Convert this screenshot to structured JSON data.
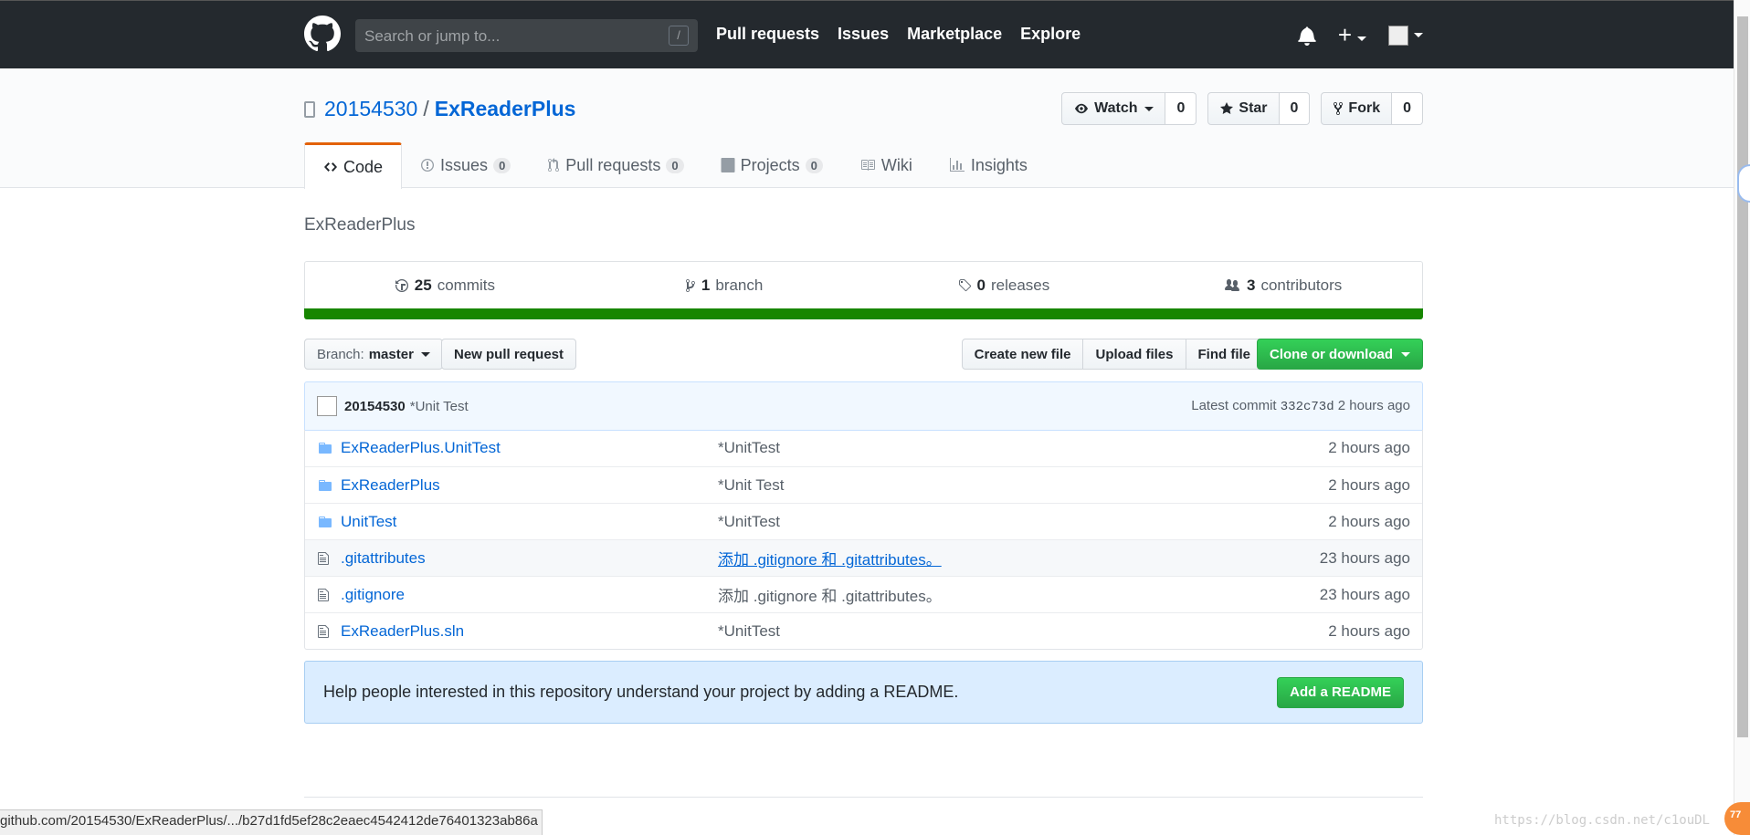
{
  "header": {
    "search_placeholder": "Search or jump to...",
    "search_shortcut": "/",
    "nav": [
      "Pull requests",
      "Issues",
      "Marketplace",
      "Explore"
    ],
    "plus": "+"
  },
  "repo": {
    "owner": "20154530",
    "separator": "/",
    "name": "ExReaderPlus",
    "watch_label": "Watch",
    "watch_count": "0",
    "star_label": "Star",
    "star_count": "0",
    "fork_label": "Fork",
    "fork_count": "0"
  },
  "tabs": [
    {
      "label": "Code",
      "count": null
    },
    {
      "label": "Issues",
      "count": "0"
    },
    {
      "label": "Pull requests",
      "count": "0"
    },
    {
      "label": "Projects",
      "count": "0"
    },
    {
      "label": "Wiki",
      "count": null
    },
    {
      "label": "Insights",
      "count": null
    }
  ],
  "description": "ExReaderPlus",
  "summary": {
    "commits_count": "25",
    "commits_label": "commits",
    "branch_count": "1",
    "branch_label": "branch",
    "releases_count": "0",
    "releases_label": "releases",
    "contributors_count": "3",
    "contributors_label": "contributors"
  },
  "file_actions": {
    "branch_prefix": "Branch:",
    "branch_name": "master",
    "new_pull_request": "New pull request",
    "create_new_file": "Create new file",
    "upload_files": "Upload files",
    "find_file": "Find file",
    "clone_or_download": "Clone or download"
  },
  "latest_commit": {
    "author": "20154530",
    "message": "*Unit Test",
    "prefix": "Latest commit",
    "sha": "332c73d",
    "age": "2 hours ago"
  },
  "files": [
    {
      "type": "folder",
      "name": "ExReaderPlus.UnitTest",
      "message": "*UnitTest",
      "age": "2 hours ago"
    },
    {
      "type": "folder",
      "name": "ExReaderPlus",
      "message": "*Unit Test",
      "age": "2 hours ago"
    },
    {
      "type": "folder",
      "name": "UnitTest",
      "message": "*UnitTest",
      "age": "2 hours ago"
    },
    {
      "type": "file",
      "name": ".gitattributes",
      "message": "添加 .gitignore 和 .gitattributes。",
      "age": "23 hours ago"
    },
    {
      "type": "file",
      "name": ".gitignore",
      "message": "添加 .gitignore 和 .gitattributes。",
      "age": "23 hours ago"
    },
    {
      "type": "file",
      "name": "ExReaderPlus.sln",
      "message": "*UnitTest",
      "age": "2 hours ago"
    }
  ],
  "readme_prompt": {
    "text": "Help people interested in this repository understand your project by adding a README.",
    "button": "Add a README"
  },
  "status_url": "github.com/20154530/ExReaderPlus/.../b27d1fd5ef28c2eaec4542412de76401323ab86a",
  "watermark": "https://blog.csdn.net/c1ouDL",
  "badge": "77",
  "colors": {
    "header_bg": "#24292e",
    "link": "#0366d6",
    "language_bar": "#178600",
    "green_button": "#28a745",
    "tab_accent": "#e36209"
  }
}
